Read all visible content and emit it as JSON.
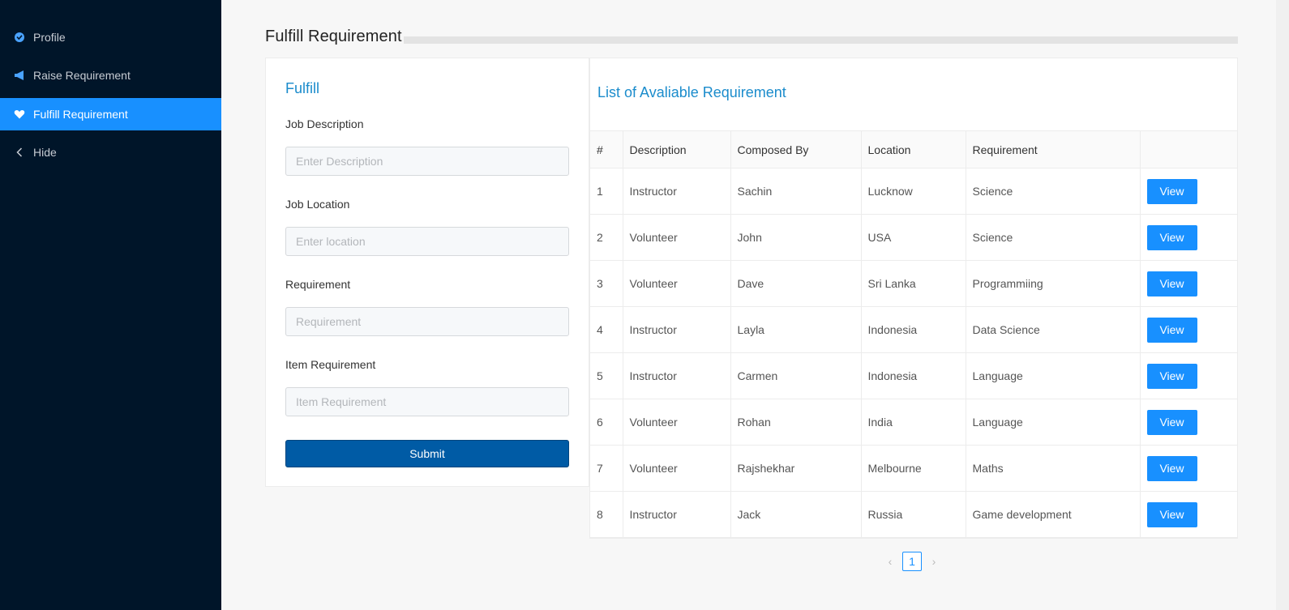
{
  "sidebar": {
    "items": [
      {
        "label": "Profile",
        "icon": "profile-icon",
        "active": false
      },
      {
        "label": "Raise Requirement",
        "icon": "megaphone-icon",
        "active": false
      },
      {
        "label": "Fulfill Requirement",
        "icon": "heart-icon",
        "active": true
      },
      {
        "label": "Hide",
        "icon": "chevron-left-icon",
        "active": false
      }
    ]
  },
  "page": {
    "title": "Fulfill Requirement"
  },
  "form": {
    "heading": "Fulfill",
    "fields": [
      {
        "label": "Job Description",
        "placeholder": "Enter Description",
        "value": ""
      },
      {
        "label": "Job Location",
        "placeholder": "Enter location",
        "value": ""
      },
      {
        "label": "Requirement",
        "placeholder": "Requirement",
        "value": ""
      },
      {
        "label": "Item Requirement",
        "placeholder": "Item Requirement",
        "value": ""
      }
    ],
    "submit_label": "Submit"
  },
  "list": {
    "heading": "List of Avaliable Requirement",
    "columns": [
      "#",
      "Description",
      "Composed By",
      "Location",
      "Requirement",
      ""
    ],
    "view_label": "View",
    "rows": [
      [
        "1",
        "Instructor",
        "Sachin",
        "Lucknow",
        "Science"
      ],
      [
        "2",
        "Volunteer",
        "John",
        "USA",
        "Science"
      ],
      [
        "3",
        "Volunteer",
        "Dave",
        "Sri Lanka",
        "Programmiing"
      ],
      [
        "4",
        "Instructor",
        "Layla",
        "Indonesia",
        "Data Science"
      ],
      [
        "5",
        "Instructor",
        "Carmen",
        "Indonesia",
        "Language"
      ],
      [
        "6",
        "Volunteer",
        "Rohan",
        "India",
        "Language"
      ],
      [
        "7",
        "Volunteer",
        "Rajshekhar",
        "Melbourne",
        "Maths"
      ],
      [
        "8",
        "Instructor",
        "Jack",
        "Russia",
        "Game development"
      ]
    ]
  },
  "pagination": {
    "current": "1",
    "prev": "‹",
    "next": "›"
  },
  "colors": {
    "sidebar_bg": "#001529",
    "active": "#1890ff",
    "heading": "#1b8ccc",
    "submit": "#005ba5"
  }
}
